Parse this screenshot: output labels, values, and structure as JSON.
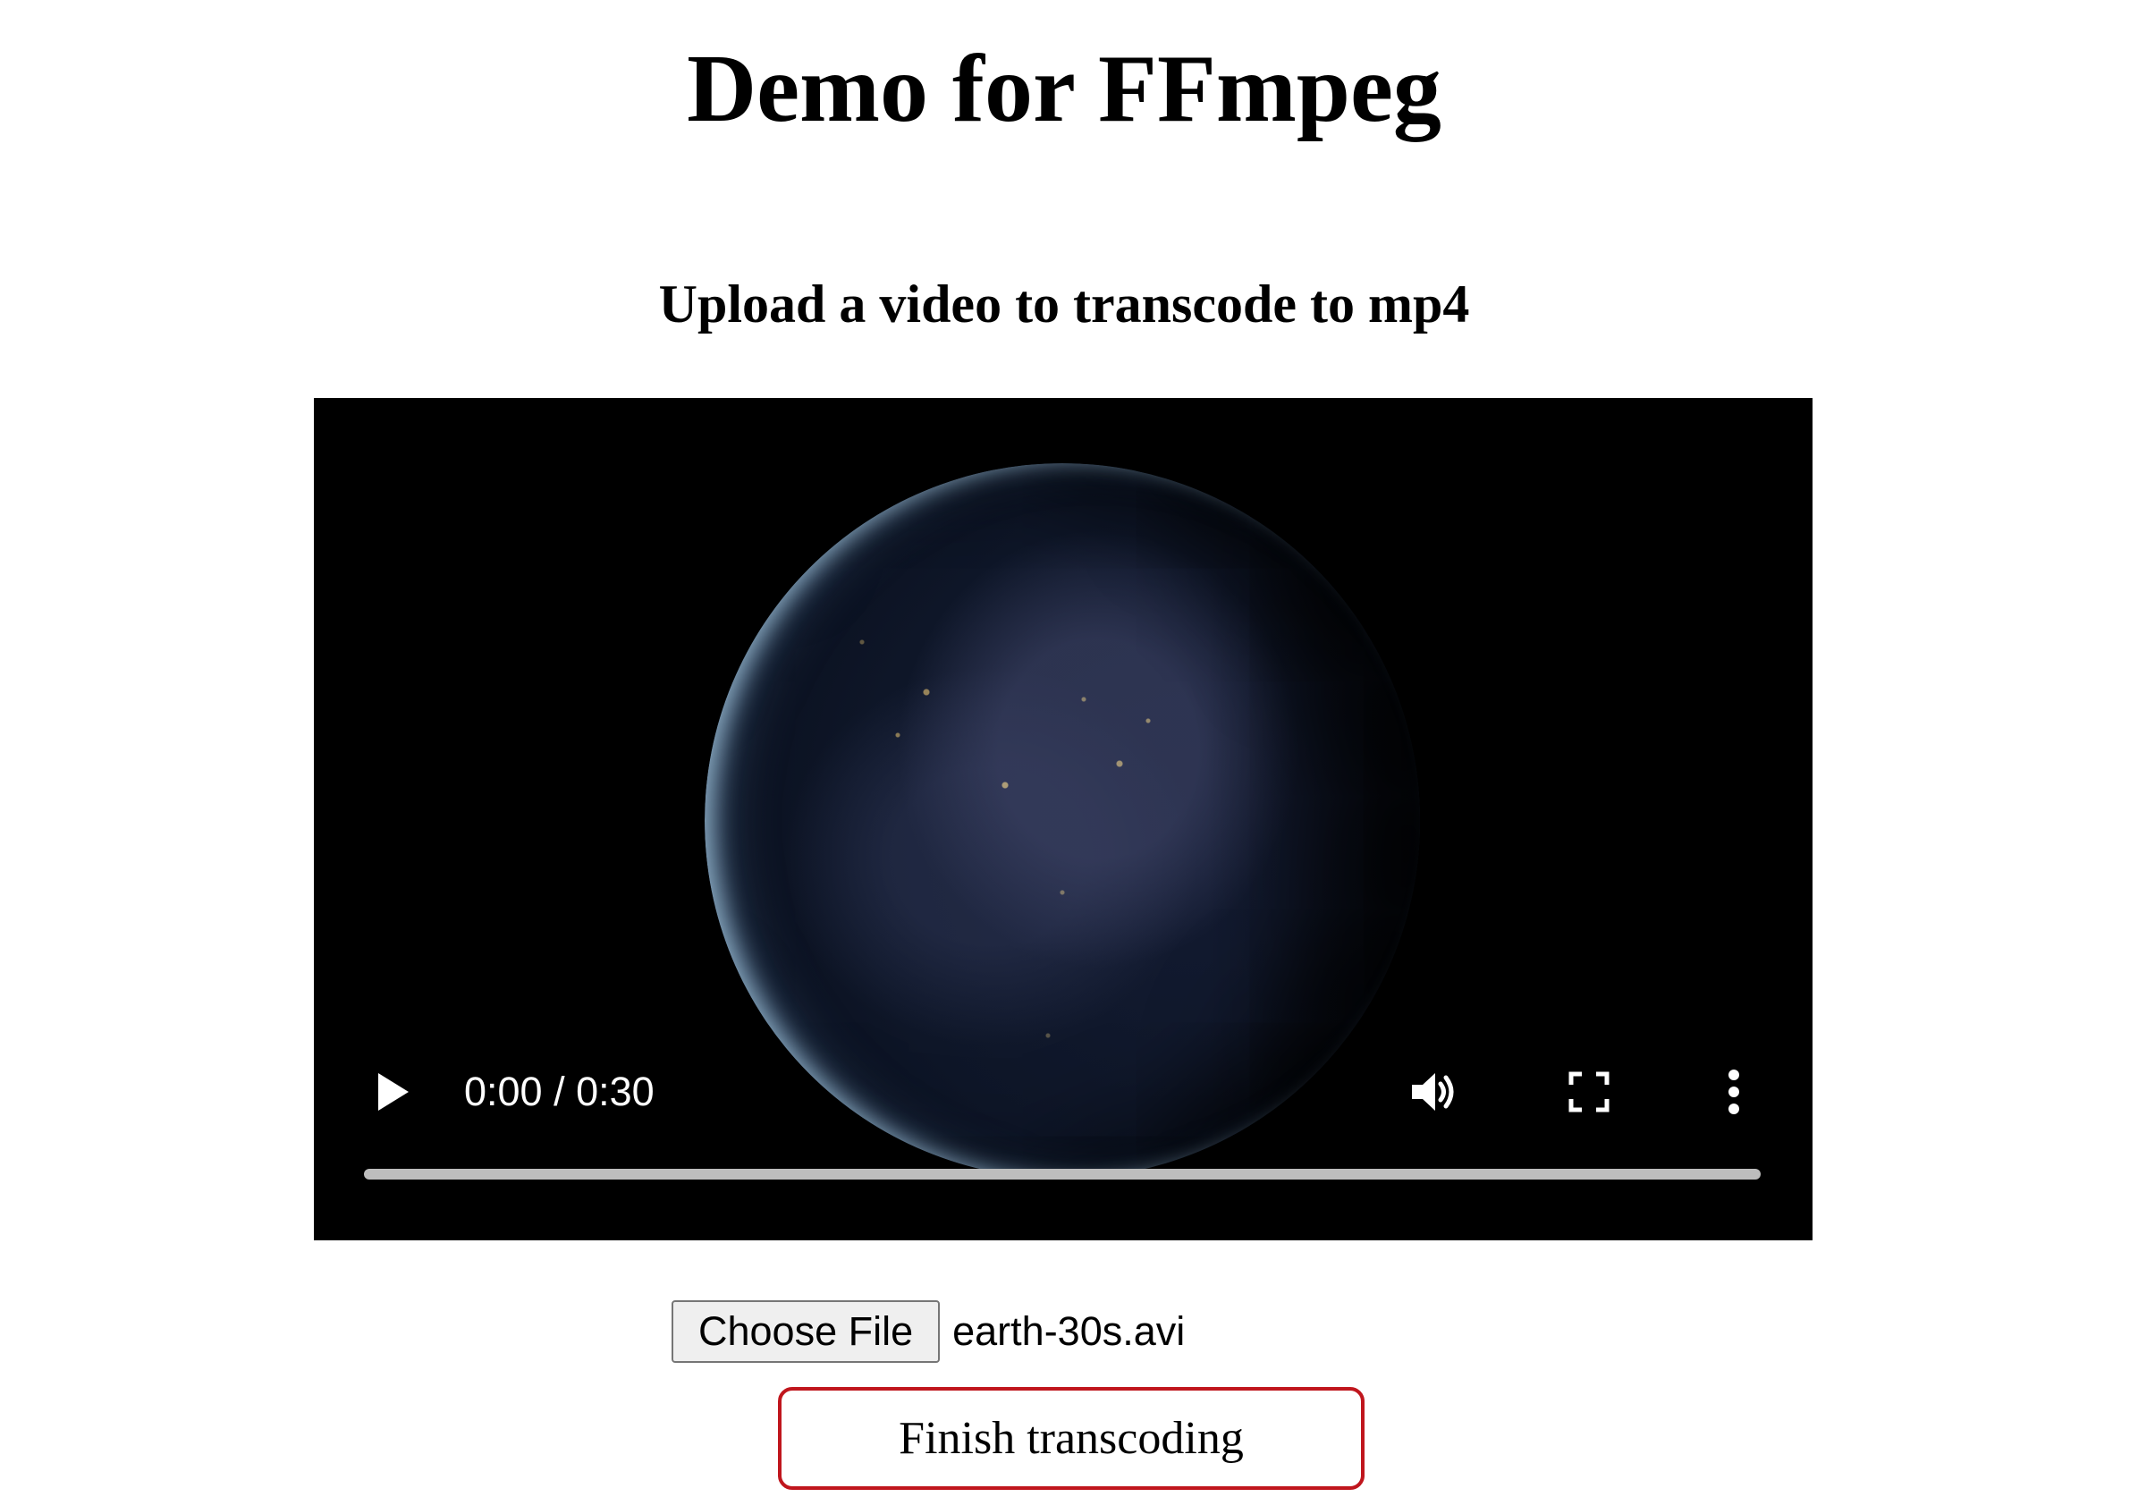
{
  "page": {
    "title": "Demo for FFmpeg",
    "subtitle": "Upload a video to transcode to mp4"
  },
  "video_player": {
    "current_time": "0:00",
    "duration": "0:30",
    "time_display": "0:00 / 0:30",
    "progress_fraction": 0,
    "icons": {
      "play": "play-icon",
      "volume": "volume-icon",
      "fullscreen": "fullscreen-icon",
      "more": "more-options-icon"
    }
  },
  "file_input": {
    "button_label": "Choose File",
    "file_name": "earth-30s.avi"
  },
  "status": {
    "message": "Finish transcoding",
    "border_color": "#c0161d"
  }
}
